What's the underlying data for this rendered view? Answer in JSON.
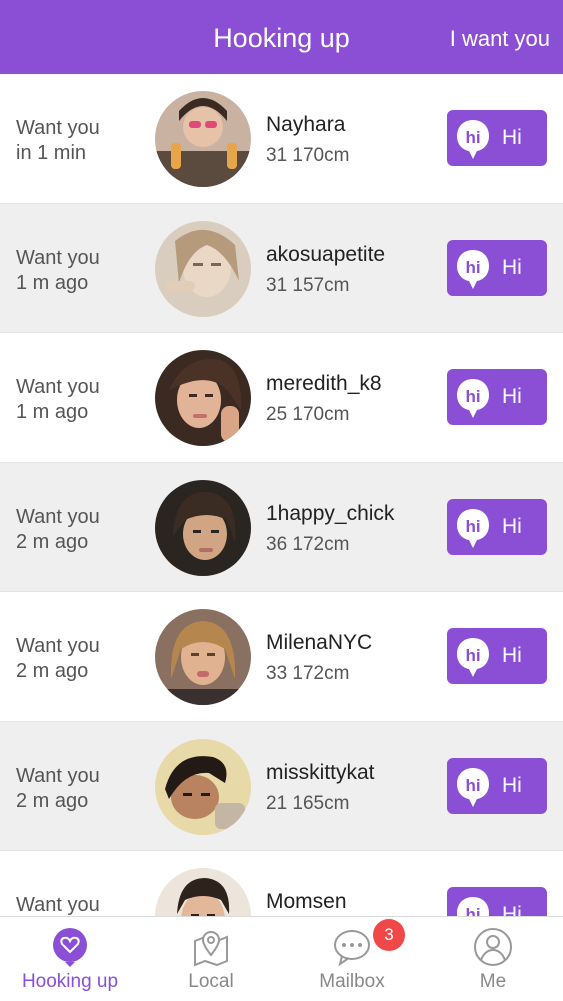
{
  "header": {
    "title": "Hooking up",
    "right_link": "I want you"
  },
  "rows": [
    {
      "when1": "Want you",
      "when2": "in 1 min",
      "name": "Nayhara",
      "meta": "31 170cm",
      "hi": "Hi"
    },
    {
      "when1": "Want you",
      "when2": "1 m ago",
      "name": "akosuapetite",
      "meta": "31 157cm",
      "hi": "Hi"
    },
    {
      "when1": "Want you",
      "when2": "1 m ago",
      "name": "meredith_k8",
      "meta": "25 170cm",
      "hi": "Hi"
    },
    {
      "when1": "Want you",
      "when2": "2 m ago",
      "name": "1happy_chick",
      "meta": "36 172cm",
      "hi": "Hi"
    },
    {
      "when1": "Want you",
      "when2": "2 m ago",
      "name": "MilenaNYC",
      "meta": "33 172cm",
      "hi": "Hi"
    },
    {
      "when1": "Want you",
      "when2": "2 m ago",
      "name": "misskittykat",
      "meta": "21 165cm",
      "hi": "Hi"
    },
    {
      "when1": "Want you",
      "when2": "",
      "name": "Momsen",
      "meta": "",
      "hi": "Hi"
    }
  ],
  "tabs": [
    {
      "label": "Hooking up",
      "icon": "heart-chat-icon"
    },
    {
      "label": "Local",
      "icon": "map-pin-icon"
    },
    {
      "label": "Mailbox",
      "icon": "chat-bubble-icon"
    },
    {
      "label": "Me",
      "icon": "user-icon"
    }
  ],
  "mailbox_badge": "3",
  "colors": {
    "accent": "#8b4fd6",
    "badge": "#f04848"
  }
}
